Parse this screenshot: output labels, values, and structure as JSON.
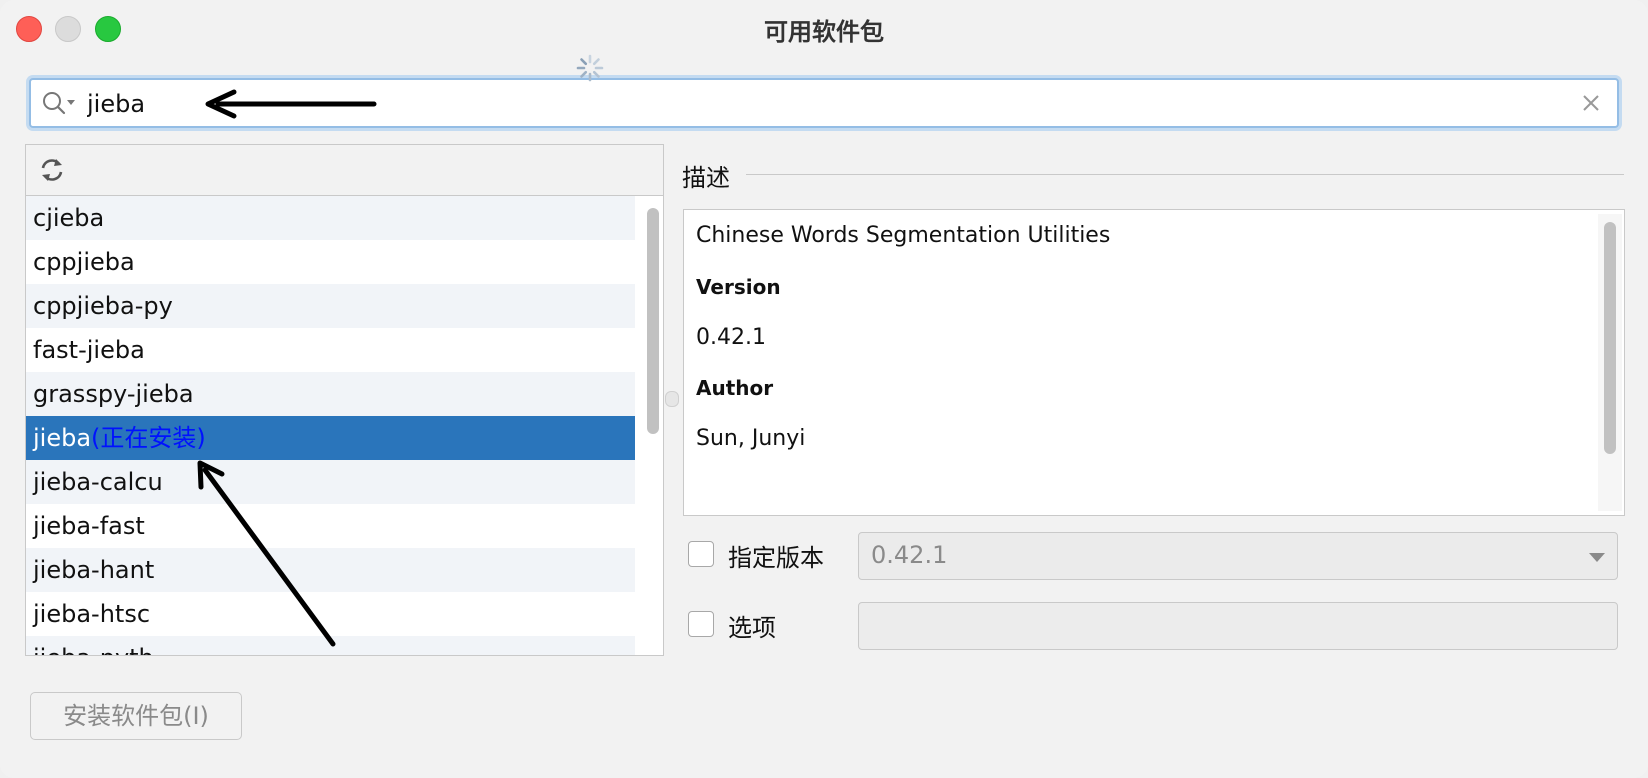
{
  "window": {
    "title": "可用软件包"
  },
  "search": {
    "value": "jieba",
    "icons": [
      "search-icon",
      "clear-icon"
    ]
  },
  "toolbar": {
    "refresh_icon": "refresh-icon"
  },
  "packages": [
    {
      "name": "cjieba",
      "status": ""
    },
    {
      "name": "cppjieba",
      "status": ""
    },
    {
      "name": "cppjieba-py",
      "status": ""
    },
    {
      "name": "fast-jieba",
      "status": ""
    },
    {
      "name": "grasspy-jieba",
      "status": ""
    },
    {
      "name": "jieba",
      "status": "(正在安装)"
    },
    {
      "name": "jieba-calcu",
      "status": ""
    },
    {
      "name": "jieba-fast",
      "status": ""
    },
    {
      "name": "jieba-hant",
      "status": ""
    },
    {
      "name": "jieba-htsc",
      "status": ""
    },
    {
      "name": "jieba-pyth",
      "status": ""
    }
  ],
  "selected_index": 5,
  "description": {
    "label": "描述",
    "summary": "Chinese Words Segmentation Utilities",
    "version_label": "Version",
    "version": "0.42.1",
    "author_label": "Author",
    "author": "Sun, Junyi"
  },
  "options": {
    "specify_version_label": "指定版本",
    "version_value": "0.42.1",
    "options_label": "选项",
    "options_value": ""
  },
  "install_button": "安装软件包(I)",
  "colors": {
    "selection": "#2a75bb",
    "installing_status": "#0011ff",
    "search_focus": "#94bde5"
  }
}
